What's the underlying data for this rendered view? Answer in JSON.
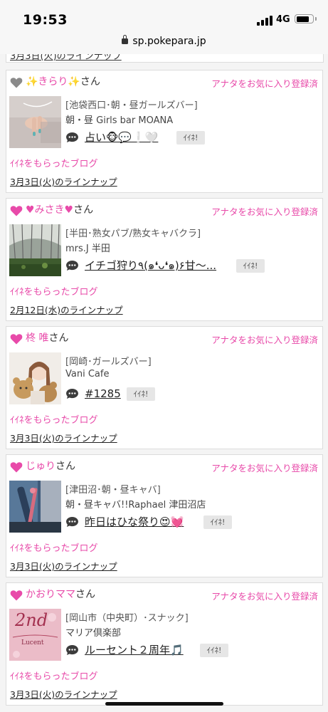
{
  "status_bar": {
    "time": "19:53",
    "network": "4G",
    "battery_level": 0.85
  },
  "browser": {
    "url": "sp.pokepara.jp"
  },
  "previous_card": {
    "lineup_text": "3月3日(火)のラインナップ"
  },
  "colors": {
    "accent_pink": "#e84aa9",
    "heart_gray": "#8a8a8a"
  },
  "cards": [
    {
      "heart_color": "gray",
      "name": "✨きらり✨",
      "honorific": "さん",
      "favorite_badge": "アナタをお気に入り登録済",
      "genre": "[池袋西口･朝・昼ガールズバー]",
      "shop": "朝・昼 Girls bar MOANA",
      "blog_title": "占い🐵💬❕🤍",
      "iine_label": "ｲｲﾈ!",
      "liked_blog_label": "ｲｲﾈをもらったブログ",
      "lineup": "3月3日(火)のラインナップ"
    },
    {
      "heart_color": "pink",
      "name": "♥みさき♥",
      "honorific": "さん",
      "favorite_badge": "アナタをお気に入り登録済",
      "genre": "[半田･熟女パブ/熟女キャバクラ]",
      "shop": "mrs.J 半田",
      "blog_title": "イチゴ狩り٩(๑❛ᴗ❛๑)۶甘〜...",
      "iine_label": "ｲｲﾈ!",
      "liked_blog_label": "ｲｲﾈをもらったブログ",
      "lineup": "2月12日(水)のラインナップ"
    },
    {
      "heart_color": "pink",
      "name": "柊 唯",
      "honorific": "さん",
      "favorite_badge": "アナタをお気に入り登録済",
      "genre": "[岡崎･ガールズバー]",
      "shop": "Vani Cafe",
      "blog_title": "#1285",
      "iine_label": "ｲｲﾈ!",
      "liked_blog_label": "ｲｲﾈをもらったブログ",
      "lineup": "3月3日(火)のラインナップ"
    },
    {
      "heart_color": "pink",
      "name": "じゅり",
      "honorific": "さん",
      "favorite_badge": "アナタをお気に入り登録済",
      "genre": "[津田沼･朝・昼キャバ]",
      "shop": "朝・昼キャバ!!Raphael 津田沼店",
      "blog_title": "昨日はひな祭り😍💓",
      "iine_label": "ｲｲﾈ!",
      "liked_blog_label": "ｲｲﾈをもらったブログ",
      "lineup": "3月3日(火)のラインナップ"
    },
    {
      "heart_color": "pink",
      "name": "かおりママ",
      "honorific": "さん",
      "favorite_badge": "アナタをお気に入り登録済",
      "genre": "[岡山市（中央町）･スナック]",
      "shop": "マリア倶楽部",
      "blog_title": "ルーセント２周年🎵",
      "iine_label": "ｲｲﾈ!",
      "liked_blog_label": "ｲｲﾈをもらったブログ",
      "lineup": "3月3日(火)のラインナップ",
      "thumbnail_text": {
        "big": "2nd",
        "small": "Lucent"
      }
    }
  ]
}
